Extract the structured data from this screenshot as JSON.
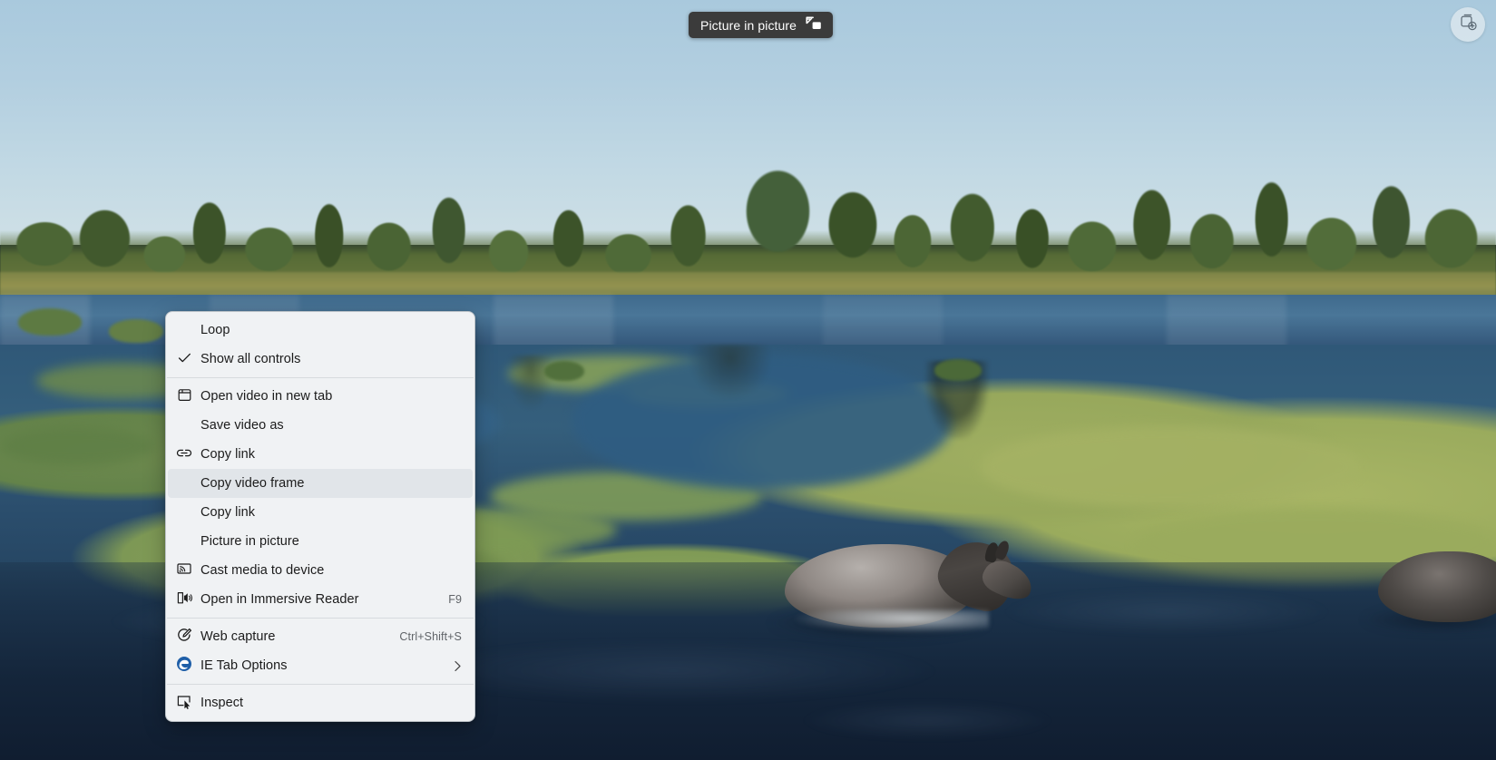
{
  "video": {
    "scene_description": "Aerial view of a shallow marshy river with green algae flats, a tree line on the horizon, a pale blue sky, and a grey horse wading in dark water"
  },
  "pip_tooltip": {
    "label": "Picture in picture",
    "icon": "picture-in-picture-icon"
  },
  "corner_button": {
    "icon": "collections-add-icon"
  },
  "context_menu": {
    "items": [
      {
        "id": "loop",
        "label": "Loop",
        "icon": "",
        "accel": "",
        "arrow": false,
        "check": false,
        "highlighted": false,
        "separator_after": false
      },
      {
        "id": "show-all-controls",
        "label": "Show all controls",
        "icon": "checkmark-icon",
        "accel": "",
        "arrow": false,
        "check": true,
        "highlighted": false,
        "separator_after": true
      },
      {
        "id": "open-video-new-tab",
        "label": "Open video in new tab",
        "icon": "new-tab-icon",
        "accel": "",
        "arrow": false,
        "check": false,
        "highlighted": false,
        "separator_after": false
      },
      {
        "id": "save-video-as",
        "label": "Save video as",
        "icon": "",
        "accel": "",
        "arrow": false,
        "check": false,
        "highlighted": false,
        "separator_after": false
      },
      {
        "id": "copy-link-1",
        "label": "Copy link",
        "icon": "link-icon",
        "accel": "",
        "arrow": false,
        "check": false,
        "highlighted": false,
        "separator_after": false
      },
      {
        "id": "copy-video-frame",
        "label": "Copy video frame",
        "icon": "",
        "accel": "",
        "arrow": false,
        "check": false,
        "highlighted": true,
        "separator_after": false
      },
      {
        "id": "copy-link-2",
        "label": "Copy link",
        "icon": "",
        "accel": "",
        "arrow": false,
        "check": false,
        "highlighted": false,
        "separator_after": false
      },
      {
        "id": "picture-in-picture",
        "label": "Picture in picture",
        "icon": "",
        "accel": "",
        "arrow": false,
        "check": false,
        "highlighted": false,
        "separator_after": false
      },
      {
        "id": "cast-media",
        "label": "Cast media to device",
        "icon": "cast-icon",
        "accel": "",
        "arrow": false,
        "check": false,
        "highlighted": false,
        "separator_after": false
      },
      {
        "id": "immersive-reader",
        "label": "Open in Immersive Reader",
        "icon": "immersive-reader-icon",
        "accel": "F9",
        "arrow": false,
        "check": false,
        "highlighted": false,
        "separator_after": true
      },
      {
        "id": "web-capture",
        "label": "Web capture",
        "icon": "web-capture-icon",
        "accel": "Ctrl+Shift+S",
        "arrow": false,
        "check": false,
        "highlighted": false,
        "separator_after": false
      },
      {
        "id": "ie-tab-options",
        "label": "IE Tab Options",
        "icon": "edge-logo-icon",
        "accel": "",
        "arrow": true,
        "check": false,
        "highlighted": false,
        "separator_after": true
      },
      {
        "id": "inspect",
        "label": "Inspect",
        "icon": "inspect-icon",
        "accel": "",
        "arrow": false,
        "check": false,
        "highlighted": false,
        "separator_after": false
      }
    ]
  },
  "colors": {
    "menu_bg": "#f0f2f4",
    "menu_highlight": "#e1e5e9",
    "menu_text": "#1b1b1b",
    "menu_accel_text": "#606468",
    "separator": "#d7dade",
    "tooltip_bg": "#3b3b3b",
    "tooltip_text": "#ffffff",
    "sky": "#b3cfe0",
    "water_far": "#3f6a8d",
    "water_near": "#14253a",
    "algae": "#9fae61"
  }
}
